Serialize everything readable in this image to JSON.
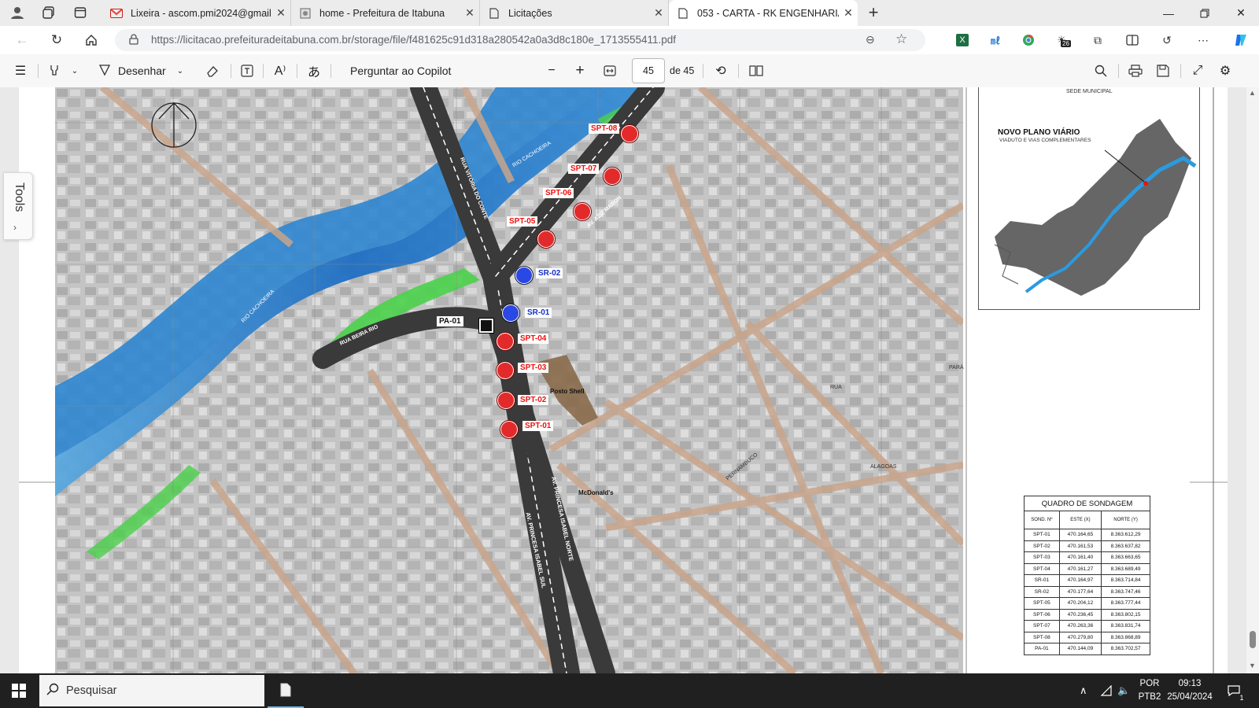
{
  "browser": {
    "tabs": [
      {
        "title": "Lixeira - ascom.pmi2024@gmail.",
        "icon": "gmail-icon"
      },
      {
        "title": "home - Prefeitura de Itabuna",
        "icon": "page-icon"
      },
      {
        "title": "Licitações",
        "icon": "page-icon"
      },
      {
        "title": "053 - CARTA - RK ENGENHARIA",
        "icon": "pdf-icon",
        "active": true
      }
    ],
    "url": "https://licitacao.prefeituradeitabuna.com.br/storage/file/f481625c91d318a280542a0a3d8c180e_1713555411.pdf",
    "extension_badge": "26"
  },
  "pdf_toolbar": {
    "draw_label": "Desenhar",
    "copilot_label": "Perguntar ao Copilot",
    "page_current": "45",
    "page_total_label": "de 45"
  },
  "sidebar": {
    "tools_label": "Tools"
  },
  "map": {
    "points": [
      {
        "id": "SPT-08",
        "type": "spt"
      },
      {
        "id": "SPT-07",
        "type": "spt"
      },
      {
        "id": "SPT-06",
        "type": "spt"
      },
      {
        "id": "SPT-05",
        "type": "spt"
      },
      {
        "id": "SR-02",
        "type": "sr"
      },
      {
        "id": "SR-01",
        "type": "sr"
      },
      {
        "id": "PA-01",
        "type": "pa"
      },
      {
        "id": "SPT-04",
        "type": "spt"
      },
      {
        "id": "SPT-03",
        "type": "spt"
      },
      {
        "id": "SPT-02",
        "type": "spt"
      },
      {
        "id": "SPT-01",
        "type": "spt"
      }
    ],
    "labels": {
      "rio1": "RIO CACHOEIRA",
      "rio2": "RIO CACHOEIRA",
      "beira_rio": "RUA BEIRA RIO",
      "vitoria": "RUA VITÓRIA DO CONTE",
      "aziz": "AV. AZIZ MARON",
      "princesa1": "AV. PRINCESA ISABEL NORTE",
      "princesa2": "AV. PRINCESA ISABEL SUL",
      "posto": "Posto Shell",
      "mcd": "McDonald's",
      "para": "PARÁ",
      "alagoas": "ALAGOAS",
      "pernambuco": "PERNAMBUCO",
      "rua": "RUA"
    }
  },
  "inset": {
    "header": "SEDE MUNICIPAL",
    "title": "NOVO PLANO VIÁRIO",
    "subtitle": "VIADUTO E VIAS COMPLEMENTARES"
  },
  "quadro": {
    "caption": "QUADRO DE SONDAGEM",
    "headers": [
      "SOND. Nº",
      "ESTE (X)",
      "NORTE (Y)"
    ],
    "rows": [
      [
        "SPT-01",
        "470.164,65",
        "8.363.612,29"
      ],
      [
        "SPT-02",
        "470.161,53",
        "8.363.637,82"
      ],
      [
        "SPT-03",
        "470.161,40",
        "8.363.663,65"
      ],
      [
        "SPT-04",
        "470.161,27",
        "8.363.689,49"
      ],
      [
        "SR-01",
        "470.164,97",
        "8.363.714,84"
      ],
      [
        "SR-02",
        "470.177,64",
        "8.363.747,46"
      ],
      [
        "SPT-05",
        "470.204,12",
        "8.363.777,44"
      ],
      [
        "SPT-06",
        "470.236,45",
        "8.363.802,15"
      ],
      [
        "SPT-07",
        "470.263,36",
        "8.363.831,74"
      ],
      [
        "SPT-08",
        "470.279,80",
        "8.363.868,89"
      ],
      [
        "PA-01",
        "470.144,09",
        "8.363.702,57"
      ]
    ]
  },
  "taskbar": {
    "search_placeholder": "Pesquisar",
    "lang": "POR",
    "layout": "PTB2",
    "time": "09:13",
    "date": "25/04/2024",
    "notification_count": "1"
  }
}
